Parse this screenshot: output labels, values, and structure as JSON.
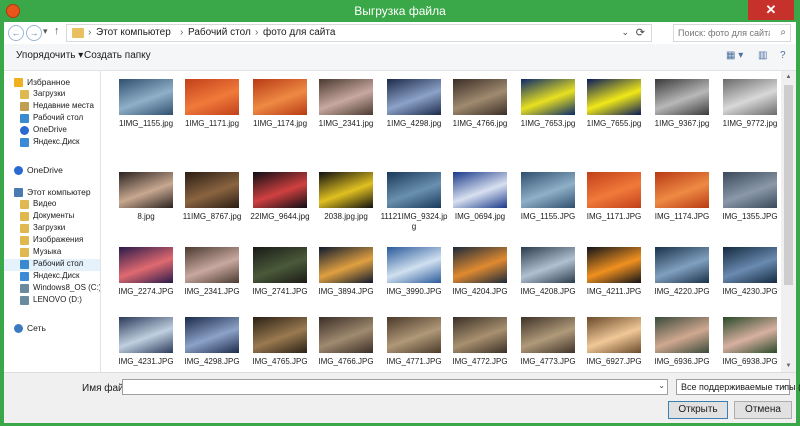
{
  "window": {
    "title": "Выгрузка файла",
    "close": "✕"
  },
  "nav": {
    "back": "←",
    "forward": "→",
    "up": "↑",
    "recent": "▾"
  },
  "breadcrumb": [
    "Этот компьютер",
    "Рабочий стол",
    "фото для сайта"
  ],
  "breadcrumb_sep": "›",
  "search": {
    "placeholder": "Поиск: фото для сайта"
  },
  "toolbar": {
    "organize": "Упорядочить ▾",
    "new_folder": "Создать папку"
  },
  "sidebar": [
    {
      "label": "Избранное",
      "icon": "star-icon",
      "head": true
    },
    {
      "label": "Загрузки",
      "icon": "downloads-folder-icon"
    },
    {
      "label": "Недавние места",
      "icon": "recent-places-icon"
    },
    {
      "label": "Рабочий стол",
      "icon": "desktop-icon"
    },
    {
      "label": "OneDrive",
      "icon": "onedrive-icon"
    },
    {
      "label": "Яндекс.Диск",
      "icon": "yandex-disk-icon"
    },
    {
      "label": "OneDrive",
      "icon": "onedrive-icon",
      "head": true
    },
    {
      "label": "Этот компьютер",
      "icon": "computer-icon",
      "head": true
    },
    {
      "label": "Видео",
      "icon": "video-folder-icon"
    },
    {
      "label": "Документы",
      "icon": "documents-folder-icon"
    },
    {
      "label": "Загрузки",
      "icon": "downloads-folder-icon"
    },
    {
      "label": "Изображения",
      "icon": "pictures-folder-icon"
    },
    {
      "label": "Музыка",
      "icon": "music-folder-icon"
    },
    {
      "label": "Рабочий стол",
      "icon": "desktop-icon",
      "selected": true
    },
    {
      "label": "Яндекс.Диск",
      "icon": "yandex-disk-icon"
    },
    {
      "label": "Windows8_OS (C:)",
      "icon": "drive-c-icon"
    },
    {
      "label": "LENOVO (D:)",
      "icon": "drive-d-icon"
    },
    {
      "label": "Сеть",
      "icon": "network-icon",
      "head": true
    }
  ],
  "files": [
    {
      "name": "1IMG_1155.jpg",
      "c1": "#2f4f6f",
      "c2": "#8fb0c8"
    },
    {
      "name": "1IMG_1171.jpg",
      "c1": "#c2401a",
      "c2": "#f07a3a"
    },
    {
      "name": "1IMG_1174.jpg",
      "c1": "#b83a14",
      "c2": "#ee8a44"
    },
    {
      "name": "1IMG_2341.jpg",
      "c1": "#4a3a30",
      "c2": "#c8a8a0"
    },
    {
      "name": "1IMG_4298.jpg",
      "c1": "#1c2a4a",
      "c2": "#8ca2c8"
    },
    {
      "name": "1IMG_4766.jpg",
      "c1": "#3a2e26",
      "c2": "#a08a70"
    },
    {
      "name": "1IMG_7653.jpg",
      "c1": "#0a2a6a",
      "c2": "#e8e020"
    },
    {
      "name": "1IMG_7655.jpg",
      "c1": "#0a1a5a",
      "c2": "#f0e818"
    },
    {
      "name": "1IMG_9367.jpg",
      "c1": "#3a3a3a",
      "c2": "#b8b8b8"
    },
    {
      "name": "1IMG_9772.jpg",
      "c1": "#6a6a6a",
      "c2": "#d8d8d8"
    },
    {
      "name": "8.jpg",
      "c1": "#2a2220",
      "c2": "#c8a890"
    },
    {
      "name": "11IMG_8767.jpg",
      "c1": "#2a1e14",
      "c2": "#8a6440"
    },
    {
      "name": "22IMG_9644.jpg",
      "c1": "#0e0e14",
      "c2": "#d04040"
    },
    {
      "name": "2038.jpg.jpg",
      "c1": "#101010",
      "c2": "#e0c020"
    },
    {
      "name": "11121IMG_9324.jpg",
      "c1": "#1a3a5a",
      "c2": "#6a90b0"
    },
    {
      "name": "IMG_0694.jpg",
      "c1": "#1a3a8a",
      "c2": "#d8e0f0"
    },
    {
      "name": "IMG_1155.JPG",
      "c1": "#2f4f6f",
      "c2": "#8fb0c8"
    },
    {
      "name": "IMG_1171.JPG",
      "c1": "#c2401a",
      "c2": "#f07a3a"
    },
    {
      "name": "IMG_1174.JPG",
      "c1": "#b83a14",
      "c2": "#ee8a44"
    },
    {
      "name": "IMG_1355.JPG",
      "c1": "#3a4a5a",
      "c2": "#8a98a8"
    },
    {
      "name": "IMG_2274.JPG",
      "c1": "#2a1a4a",
      "c2": "#e06a70"
    },
    {
      "name": "IMG_2341.JPG",
      "c1": "#4a3a30",
      "c2": "#c8a8a0"
    },
    {
      "name": "IMG_2741.JPG",
      "c1": "#1a1a16",
      "c2": "#4a5a3a"
    },
    {
      "name": "IMG_3894.JPG",
      "c1": "#0e1a2e",
      "c2": "#e0a040"
    },
    {
      "name": "IMG_3990.JPG",
      "c1": "#2a5a9a",
      "c2": "#d0e0f0"
    },
    {
      "name": "IMG_4204.JPG",
      "c1": "#1a2a3a",
      "c2": "#e08a30"
    },
    {
      "name": "IMG_4208.JPG",
      "c1": "#2a3a4a",
      "c2": "#b0c0d0"
    },
    {
      "name": "IMG_4211.JPG",
      "c1": "#101418",
      "c2": "#f09020"
    },
    {
      "name": "IMG_4220.JPG",
      "c1": "#1a3048",
      "c2": "#80a0c0"
    },
    {
      "name": "IMG_4230.JPG",
      "c1": "#142a40",
      "c2": "#6a8ab0"
    },
    {
      "name": "IMG_4231.JPG",
      "c1": "#2a3a5a",
      "c2": "#c0d0e0"
    },
    {
      "name": "IMG_4298.JPG",
      "c1": "#1c2a4a",
      "c2": "#8ca2c8"
    },
    {
      "name": "IMG_4765.JPG",
      "c1": "#2a2016",
      "c2": "#9a7a50"
    },
    {
      "name": "IMG_4766.JPG",
      "c1": "#3a2e26",
      "c2": "#a08a70"
    },
    {
      "name": "IMG_4771.JPG",
      "c1": "#4a3a2a",
      "c2": "#b09878"
    },
    {
      "name": "IMG_4772.JPG",
      "c1": "#3a3026",
      "c2": "#a89070"
    },
    {
      "name": "IMG_4773.JPG",
      "c1": "#3e3228",
      "c2": "#b09a7a"
    },
    {
      "name": "IMG_6927.JPG",
      "c1": "#6a4a2a",
      "c2": "#f0c898"
    },
    {
      "name": "IMG_6936.JPG",
      "c1": "#3a4a3a",
      "c2": "#d0a890"
    },
    {
      "name": "IMG_6938.JPG",
      "c1": "#2a4a2a",
      "c2": "#d8b0a0"
    },
    {
      "name": "",
      "c1": "#1a2a4a",
      "c2": "#7a8ab0"
    },
    {
      "name": "",
      "c1": "#4a3a3a",
      "c2": "#a89080"
    },
    {
      "name": "",
      "c1": "#2a3a4a",
      "c2": "#90a0b0"
    },
    {
      "name": "",
      "c1": "#1a1a2a",
      "c2": "#505a70"
    },
    {
      "name": "",
      "c1": "#1a2a3a",
      "c2": "#a0b0c0"
    },
    {
      "name": "",
      "c1": "#0a1a5a",
      "c2": "#3040a0"
    },
    {
      "name": "",
      "c1": "#2a2a2a",
      "c2": "#707070"
    },
    {
      "name": "",
      "c1": "#3a4a5a",
      "c2": "#a0b8d0"
    },
    {
      "name": "",
      "c1": "#1a3a2a",
      "c2": "#60a060"
    },
    {
      "name": "",
      "c1": "#2a3a1a",
      "c2": "#98c040"
    }
  ],
  "bottom": {
    "filename_label": "Имя файла:",
    "filename_value": "",
    "filetype": "Все поддерживаемые типы (*.",
    "open": "Открыть",
    "cancel": "Отмена",
    "dropdown_glyph": "⌄"
  },
  "view_icons": {
    "change_view": "▦ ▾",
    "preview": "▥",
    "help": "?"
  }
}
